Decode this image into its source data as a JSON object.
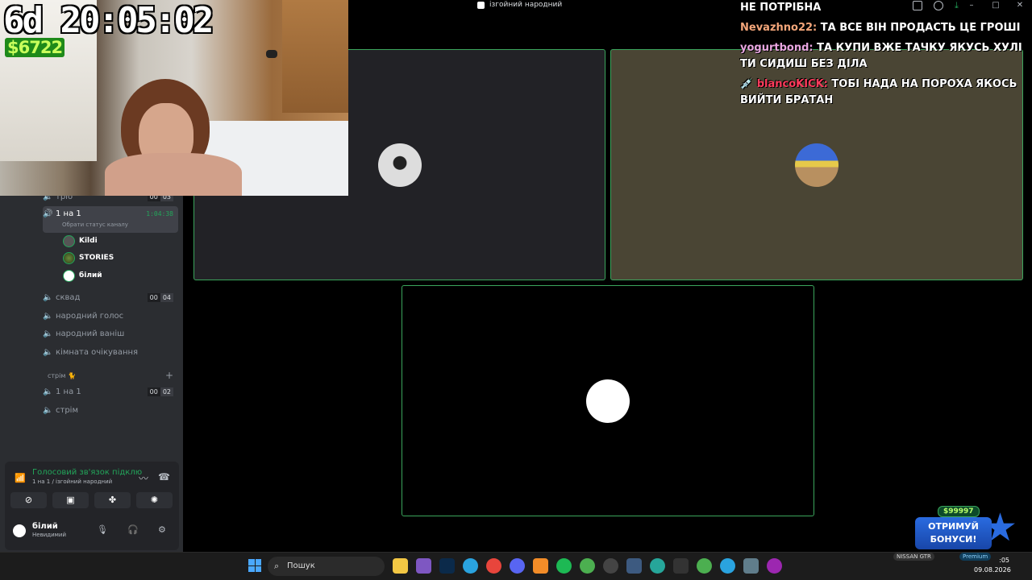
{
  "window": {
    "title": "ізгойний народний",
    "controls": [
      "–",
      "□",
      "✕"
    ]
  },
  "stream_overlay": {
    "timer": "6d 20:05:02",
    "money": "$6722"
  },
  "sidebar": {
    "channels": [
      {
        "name": "тріо",
        "badge": [
          "00",
          "03"
        ]
      },
      {
        "name": "1 на 1",
        "time": "1:04:38",
        "status_hint": "Обрати статус каналу"
      },
      {
        "name": "сквад",
        "badge": [
          "00",
          "04"
        ]
      },
      {
        "name": "народний голос"
      },
      {
        "name": "народний ваніш"
      },
      {
        "name": "кімната очікування"
      }
    ],
    "members": [
      "Kildi",
      "STORIES",
      "білий"
    ],
    "category": "стрім 🐈",
    "stream_channels": [
      {
        "name": "1 на 1",
        "badge": [
          "00",
          "02"
        ]
      },
      {
        "name": "стрім"
      }
    ]
  },
  "voice_panel": {
    "status": "Голосовий зв'язок підклю",
    "location": "1 на 1 / ізгойний народний"
  },
  "user_panel": {
    "name": "білий",
    "state": "Невидимий"
  },
  "chat": [
    {
      "user": "",
      "text": "НЕ ПОТРІБНА",
      "color": "#ffffff"
    },
    {
      "user": "Nevazhno22:",
      "text": "ТА ВСЕ ВІН ПРОДАСТЬ ЦЕ ГРОШІ",
      "color": "#f4a67a"
    },
    {
      "user": "yogurtbond:",
      "text": "ТА КУПИ ВЖЕ ТАЧКУ ЯКУСЬ ХУЛІ ТИ СИДИШ БЕЗ ДІЛА",
      "color": "#e8a6e0"
    },
    {
      "user": "💉 blancoKICK:",
      "text": "ТОБІ НАДА НА ПОРОХА ЯКОСЬ ВИЙТИ БРАТАН",
      "color": "#ff3b5c"
    }
  ],
  "promo": {
    "amount": "$99997",
    "label_line1": "ОТРИМУЙ",
    "label_line2": "БОНУСИ!"
  },
  "taskbar": {
    "search_placeholder": "Пошук",
    "tray_nissan": "NISSAN GTR",
    "tray_premium": "Premium",
    "time": ":05",
    "date": "09.08.2026"
  },
  "colors": {
    "accent_green": "#23a55a",
    "tile_border": "#3ba55c",
    "sidebar_bg": "#2b2d31"
  }
}
